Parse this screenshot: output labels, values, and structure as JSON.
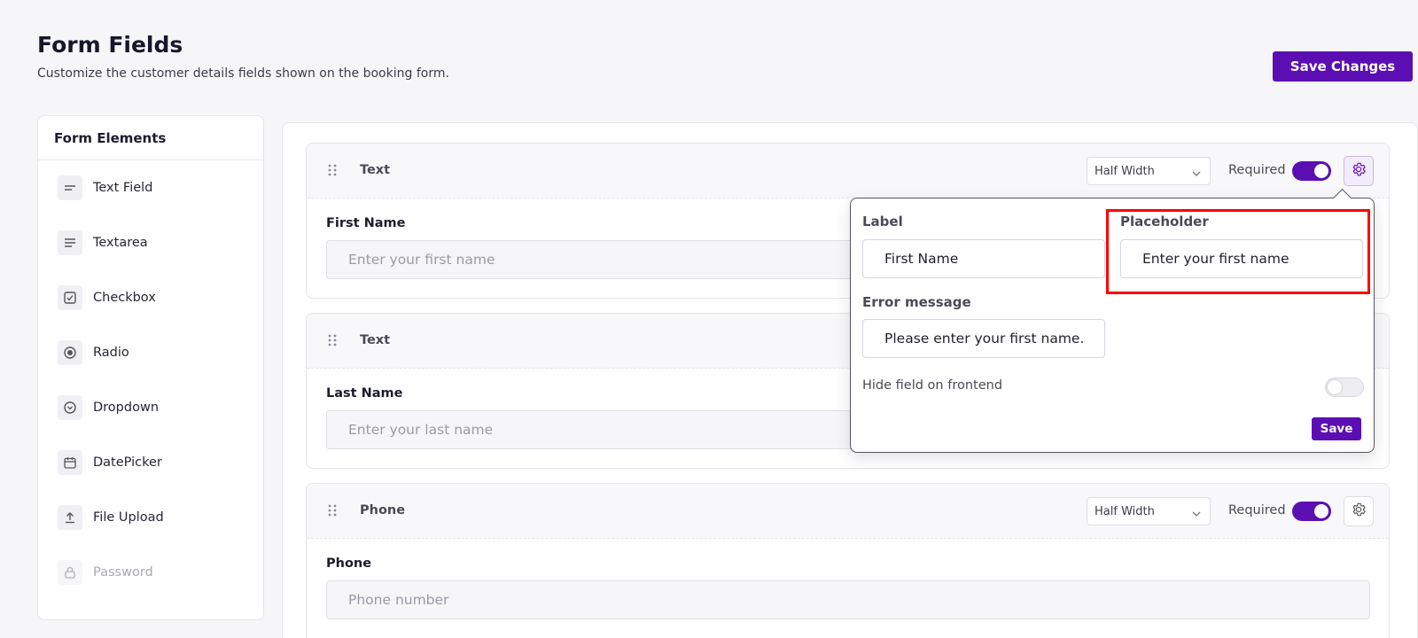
{
  "header": {
    "title": "Form Fields",
    "subtitle": "Customize the customer details fields shown on the booking form.",
    "save_changes_label": "Save Changes"
  },
  "sidebar": {
    "title": "Form Elements",
    "items": [
      {
        "label": "Text Field",
        "icon": "text-field-icon"
      },
      {
        "label": "Textarea",
        "icon": "textarea-icon"
      },
      {
        "label": "Checkbox",
        "icon": "checkbox-icon"
      },
      {
        "label": "Radio",
        "icon": "radio-icon"
      },
      {
        "label": "Dropdown",
        "icon": "dropdown-icon"
      },
      {
        "label": "DatePicker",
        "icon": "calendar-icon"
      },
      {
        "label": "File Upload",
        "icon": "upload-icon"
      },
      {
        "label": "Password",
        "icon": "lock-icon",
        "disabled": true
      }
    ]
  },
  "fields": [
    {
      "type": "Text",
      "width": "Half Width",
      "required_label": "Required",
      "required": true,
      "label": "First Name",
      "placeholder": "Enter your first name"
    },
    {
      "type": "Text",
      "label": "Last Name",
      "placeholder": "Enter your last name"
    },
    {
      "type": "Phone",
      "width": "Half Width",
      "required_label": "Required",
      "required": true,
      "label": "Phone",
      "placeholder": "Phone number"
    }
  ],
  "popover": {
    "label_title": "Label",
    "label_value": "First Name",
    "placeholder_title": "Placeholder",
    "placeholder_value": "Enter your first name",
    "error_title": "Error message",
    "error_value": "Please enter your first name.",
    "hide_label": "Hide field on frontend",
    "hide_enabled": false,
    "save_label": "Save"
  },
  "colors": {
    "accent": "#5b0fb3",
    "highlight": "#ff0000"
  }
}
